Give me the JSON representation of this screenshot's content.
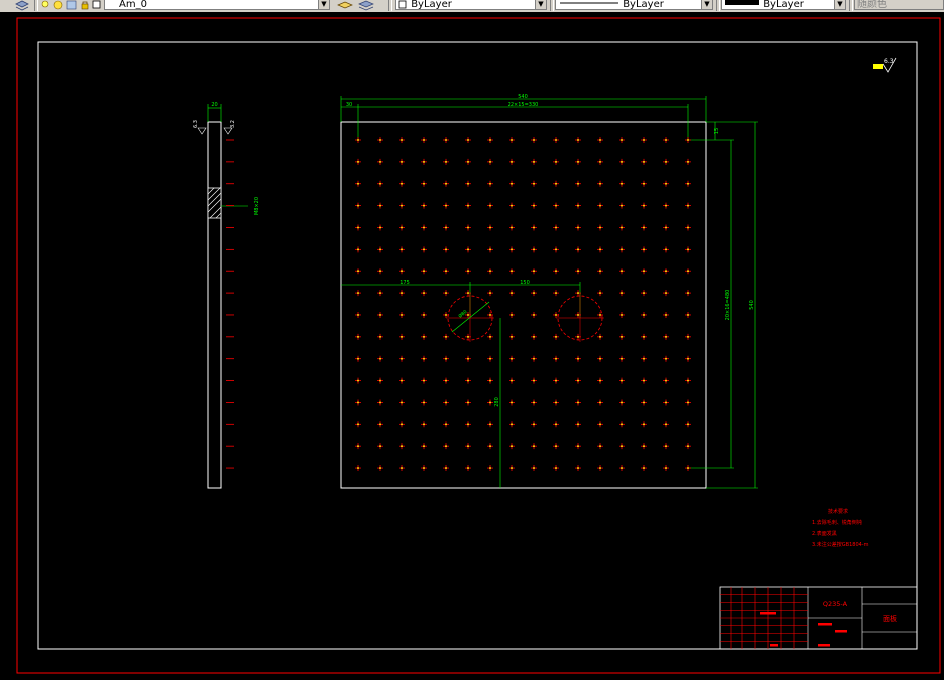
{
  "toolbar": {
    "layer_name": "Am_0",
    "color_value": "ByLayer",
    "linetype_value": "ByLayer",
    "lineweight_value": "ByLayer",
    "plotstyle_value": "随颜色"
  },
  "drawing": {
    "width_dim": "540",
    "spacing_dim": "30",
    "spacing_total_dim": "22×15=330",
    "height_dim": "540",
    "vert_total_dim": "20×16=480",
    "small_dim_top": "15",
    "hole_pitch_dim": "175",
    "hole_center_dim": "150",
    "hole_depth_dim": "280",
    "hole_diam_dim": "Ø80",
    "side_width_dim": "20",
    "side_hole_dim": "M8×20",
    "roughness_left": "6.3",
    "roughness_right": "3.2",
    "roughness_corner": "6.3"
  },
  "notes": {
    "title": "技术要求",
    "lines": [
      "1.去除毛刺、锐角倒钝",
      "2.表面发黑",
      "3.未注公差按GB1804-m"
    ]
  },
  "title_block": {
    "material": "Q235-A",
    "part_name": "面板"
  },
  "colors": {
    "frame": "#ffffff",
    "border": "#ff0000",
    "dimension": "#00ff00",
    "hole_mark": "#ff0000",
    "center_mark": "#ffff00"
  }
}
